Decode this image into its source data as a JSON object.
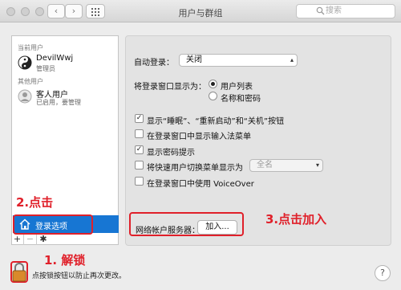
{
  "window": {
    "title": "用户与群组"
  },
  "toolbar": {
    "back_icon": "chevron-left-icon",
    "forward_icon": "chevron-right-icon",
    "grid_icon": "grid-icon"
  },
  "search": {
    "placeholder": "搜索"
  },
  "sidebar": {
    "current_users_header": "当前用户",
    "current_user": {
      "name": "DevilWwj",
      "role": "管理员"
    },
    "other_users_header": "其他用户",
    "guest_user": {
      "name": "客人用户",
      "status": "已启用，要管理"
    },
    "selected_item": "登录选项"
  },
  "settings": {
    "auto_login_label": "自动登录：",
    "auto_login_value": "关闭",
    "login_window_label": "将登录窗口显示为：",
    "radio_options": [
      {
        "label": "用户列表",
        "selected": true
      },
      {
        "label": "名称和密码",
        "selected": false
      }
    ],
    "checkboxes": [
      {
        "label": "显示“睡眠”、“重新启动”和“关机”按钮",
        "checked": true
      },
      {
        "label": "在登录窗口中显示输入法菜单",
        "checked": false
      },
      {
        "label": "显示密码提示",
        "checked": true
      },
      {
        "label": "将快速用户切换菜单显示为",
        "checked": false
      },
      {
        "label": "在登录窗口中使用 VoiceOver",
        "checked": false
      }
    ],
    "fast_user_switch_value": "全名",
    "network_server_label": "网络帐户服务器：",
    "join_button": "加入..."
  },
  "annotations": {
    "step1": "1. 解锁",
    "step2": "2.点击",
    "step3": "3.点击加入",
    "color": "#e0202a"
  },
  "footer": {
    "lock_message": "点按锁按钮以防止再次更改。",
    "help": "?"
  },
  "accent": "#1776d3"
}
